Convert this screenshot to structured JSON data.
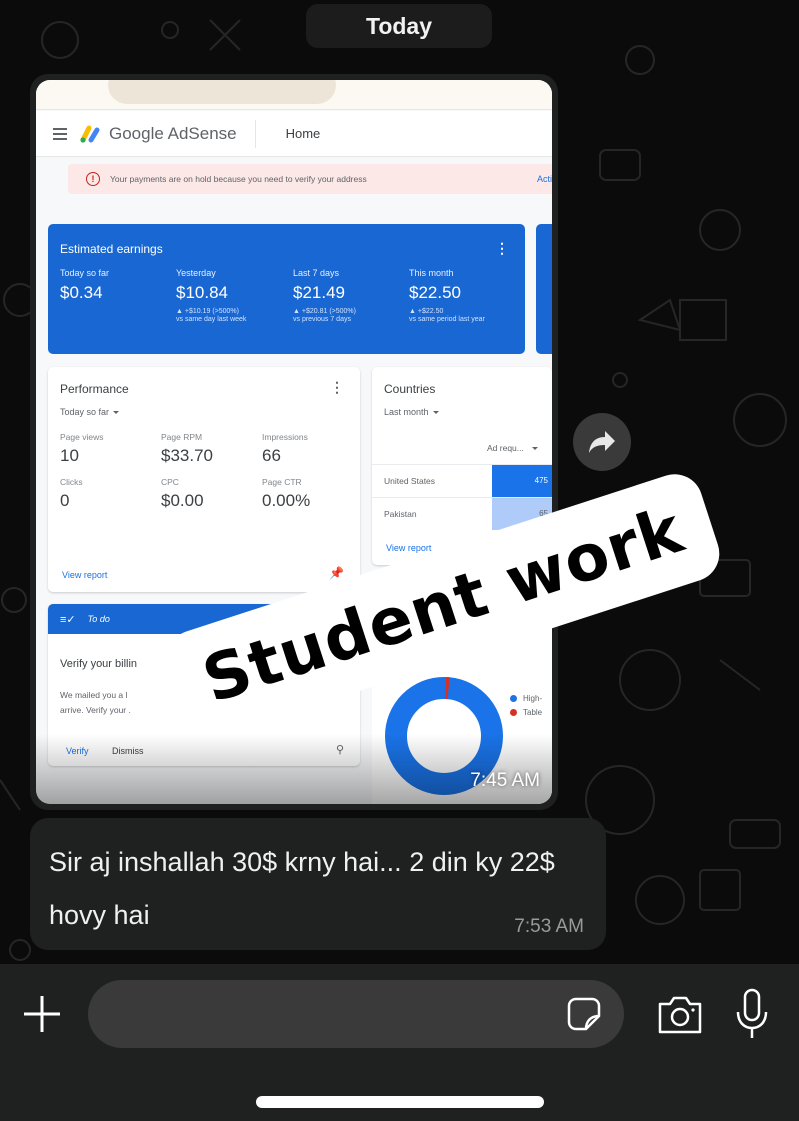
{
  "chat": {
    "date_separator": "Today",
    "image_message": {
      "time": "7:45 AM",
      "watermark": "Student work",
      "screenshot": {
        "app_title": "Google AdSense",
        "nav_page": "Home",
        "alert": {
          "text": "Your payments are on hold because you need to verify your address",
          "action": "Acti"
        },
        "estimated_earnings": {
          "title": "Estimated earnings",
          "columns": [
            {
              "label": "Today so far",
              "value": "$0.34",
              "delta": "",
              "note": ""
            },
            {
              "label": "Yesterday",
              "value": "$10.84",
              "delta": "▲ +$10.19 (>500%)",
              "note": "vs same day last week"
            },
            {
              "label": "Last 7 days",
              "value": "$21.49",
              "delta": "▲ +$20.81 (>500%)",
              "note": "vs previous 7 days"
            },
            {
              "label": "This month",
              "value": "$22.50",
              "delta": "▲ +$22.50",
              "note": "vs same period last year"
            }
          ]
        },
        "performance": {
          "title": "Performance",
          "filter": "Today so far",
          "metrics": [
            {
              "label": "Page views",
              "value": "10"
            },
            {
              "label": "Page RPM",
              "value": "$33.70"
            },
            {
              "label": "Impressions",
              "value": "66"
            },
            {
              "label": "Clicks",
              "value": "0"
            },
            {
              "label": "CPC",
              "value": "$0.00"
            },
            {
              "label": "Page CTR",
              "value": "0.00%"
            }
          ],
          "view_report": "View report"
        },
        "countries": {
          "title": "Countries",
          "filter": "Last month",
          "metric_select": "Ad requ...",
          "rows": [
            {
              "country": "United States",
              "value": "475",
              "color": "#1a73e8"
            },
            {
              "country": "Pakistan",
              "value": "65",
              "color": "#aecbfa"
            }
          ],
          "view_report": "View report"
        },
        "todo": {
          "header": "To do",
          "title": "Verify your billin",
          "body_line1": "We mailed you a l",
          "body_line2": "arrive. Verify your .",
          "verify": "Verify",
          "dismiss": "Dismiss"
        },
        "platforms": {
          "legend": [
            {
              "label": "High-",
              "color": "#1a73e8"
            },
            {
              "label": "Table",
              "color": "#d93025"
            }
          ],
          "donut_share": [
            0.99,
            0.01
          ]
        }
      }
    },
    "text_message": {
      "text": "Sir aj inshallah 30$ krny hai... 2 din ky 22$ hovy hai",
      "time": "7:53 AM"
    }
  },
  "composer": {
    "input_value": "",
    "input_placeholder": ""
  },
  "colors": {
    "adsense_blue": "#1967d2",
    "bubble": "#1f2020",
    "composer": "#1f2020"
  }
}
